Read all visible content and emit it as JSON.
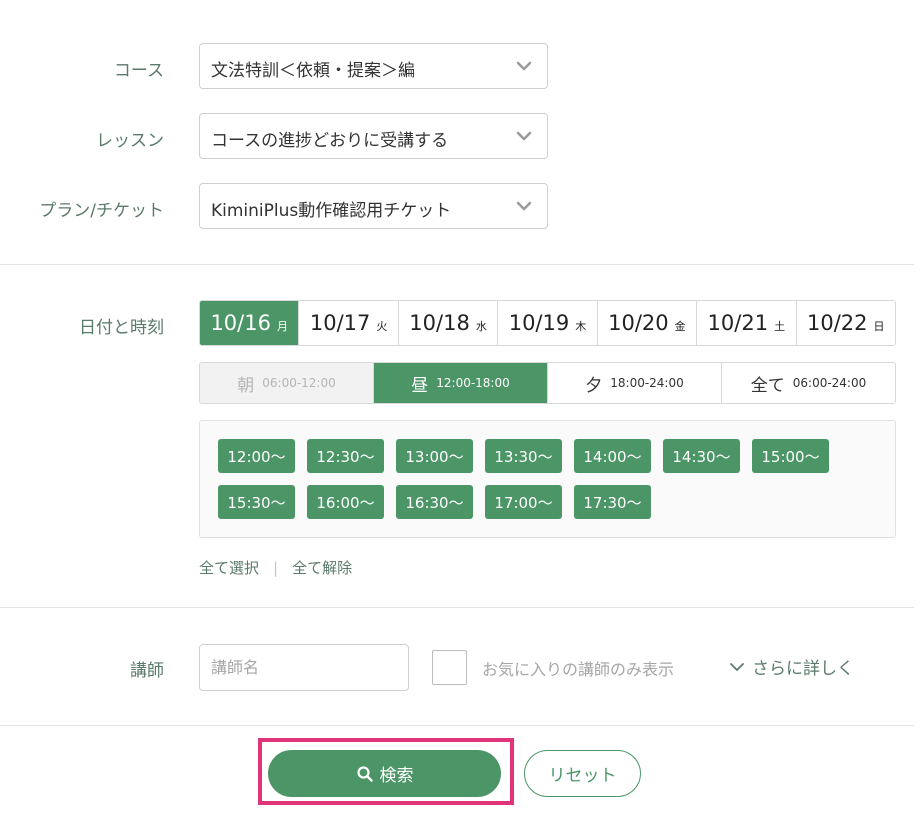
{
  "form": {
    "course": {
      "label": "コース",
      "value": "文法特訓＜依頼・提案＞編"
    },
    "lesson": {
      "label": "レッスン",
      "value": "コースの進捗どおりに受講する"
    },
    "plan": {
      "label": "プラン/チケット",
      "value": "KiminiPlus動作確認用チケット"
    }
  },
  "datetime": {
    "label": "日付と時刻",
    "dates": [
      {
        "date": "10/16",
        "weekday": "月",
        "selected": true
      },
      {
        "date": "10/17",
        "weekday": "火",
        "selected": false
      },
      {
        "date": "10/18",
        "weekday": "水",
        "selected": false
      },
      {
        "date": "10/19",
        "weekday": "木",
        "selected": false
      },
      {
        "date": "10/20",
        "weekday": "金",
        "selected": false
      },
      {
        "date": "10/21",
        "weekday": "土",
        "selected": false
      },
      {
        "date": "10/22",
        "weekday": "日",
        "selected": false
      }
    ],
    "periods": [
      {
        "name": "朝",
        "time": "06:00-12:00",
        "state": "disabled"
      },
      {
        "name": "昼",
        "time": "12:00-18:00",
        "state": "selected"
      },
      {
        "name": "夕",
        "time": "18:00-24:00",
        "state": "normal"
      },
      {
        "name": "全て",
        "time": "06:00-24:00",
        "state": "normal"
      }
    ],
    "slots": [
      "12:00〜",
      "12:30〜",
      "13:00〜",
      "13:30〜",
      "14:00〜",
      "14:30〜",
      "15:00〜",
      "15:30〜",
      "16:00〜",
      "16:30〜",
      "17:00〜",
      "17:30〜"
    ],
    "select_all": "全て選択",
    "deselect_all": "全て解除"
  },
  "teacher": {
    "label": "講師",
    "placeholder": "講師名",
    "favorites_only_label": "お気に入りの講師のみ表示",
    "favorites_only_checked": false,
    "more_label": "さらに詳しく"
  },
  "actions": {
    "search_label": "検索",
    "reset_label": "リセット"
  },
  "colors": {
    "accent": "#4b9567",
    "highlight": "#e2347a"
  }
}
